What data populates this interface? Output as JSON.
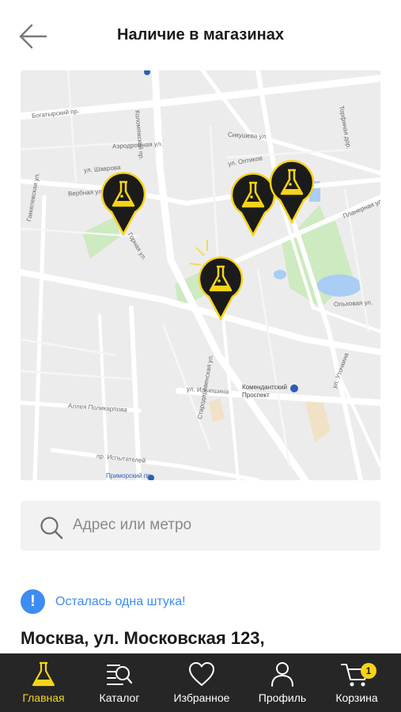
{
  "header": {
    "title": "Наличие в магазинах",
    "back_icon": "arrow-left-icon"
  },
  "map": {
    "street_labels": [
      "Богатырский пр.",
      "Аэродромная ул.",
      "ул. Шаврова",
      "Вербная ул.",
      "Гаккелевская ул.",
      "Горная ул.",
      "Коломяжский пр.",
      "ул. Оптиков",
      "Сикушева ул.",
      "Торфяная дор.",
      "Ольховая ул.",
      "Планерная ул.",
      "Комендантский Проспект",
      "ул. Ильюшина",
      "Аллея Поликарпова",
      "пр. Испытателей",
      "ул. Уточкина",
      "Стародеревенская ул.",
      "Приморский пр."
    ],
    "pin_icon": "flask-map-pin-icon",
    "pin_color": "#f7d417"
  },
  "search": {
    "placeholder": "Адрес или метро",
    "icon": "search-icon"
  },
  "notice": {
    "icon": "info-icon",
    "icon_glyph": "!",
    "text": "Осталась одна штука!",
    "color": "#3d8cf1"
  },
  "store": {
    "address": "Москва, ул. Московская 123,"
  },
  "tabbar": {
    "background": "#262626",
    "accent": "#f7d417",
    "tabs": [
      {
        "label": "Главная",
        "icon": "flask-icon",
        "active": true
      },
      {
        "label": "Каталог",
        "icon": "catalog-search-icon",
        "active": false
      },
      {
        "label": "Избранное",
        "icon": "heart-icon",
        "active": false
      },
      {
        "label": "Профиль",
        "icon": "user-icon",
        "active": false
      },
      {
        "label": "Корзина",
        "icon": "cart-icon",
        "active": false,
        "badge": "1"
      }
    ]
  }
}
